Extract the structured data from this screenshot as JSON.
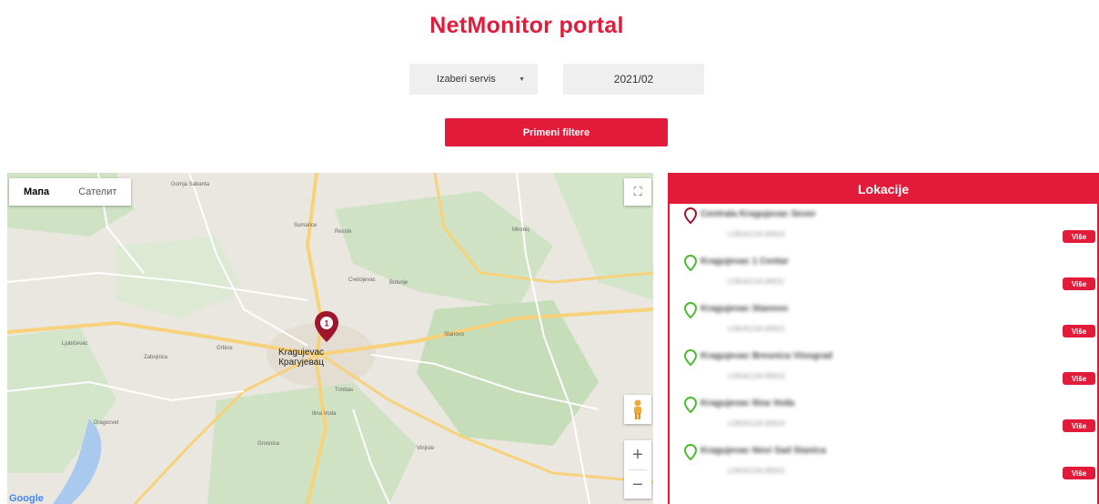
{
  "page": {
    "title": "NetMonitor portal"
  },
  "filters": {
    "service_label": "Izaberi servis",
    "date_value": "2021/02",
    "apply_label": "Primeni filtere"
  },
  "map": {
    "map_type_map": "Мапа",
    "map_type_satellite": "Сателит",
    "cluster_count": "1",
    "city_name": "Kragujevac",
    "city_name_cyrillic": "Крагујевац",
    "google_logo": "Google",
    "zoom_in": "+",
    "zoom_out": "−",
    "labels": [
      "Gornja Sabanta",
      "Zabojnica",
      "Sumarice",
      "Cvetojevac",
      "Stanovo",
      "Grosnica",
      "Ilina Voda",
      "Botunje",
      "Vinjiste",
      "Trmbas",
      "Mironic",
      "Dragocvet",
      "Ljubičevac",
      "Grbice",
      "Resnik"
    ]
  },
  "locations": {
    "header": "Lokacije",
    "button_label": "Više",
    "items": [
      {
        "name": "Centrala Kragujevac Sever",
        "sub": "LOKACIJA 00010",
        "status": "warning"
      },
      {
        "name": "Kragujevac 1 Centar",
        "sub": "LOKACIJA 00011",
        "status": "ok"
      },
      {
        "name": "Kragujevac Stanovo",
        "sub": "LOKACIJA 00012",
        "status": "ok"
      },
      {
        "name": "Kragujevac Bresnica Vinograd",
        "sub": "LOKACIJA 00013",
        "status": "ok"
      },
      {
        "name": "Kragujevac Ilina Voda",
        "sub": "LOKACIJA 00014",
        "status": "ok"
      },
      {
        "name": "Kragujevac Novi Sad Stanica",
        "sub": "LOKACIJA 00015",
        "status": "ok"
      }
    ]
  },
  "colors": {
    "accent": "#e31b3a",
    "ok": "#4cbb2e",
    "warning": "#a0142c"
  }
}
